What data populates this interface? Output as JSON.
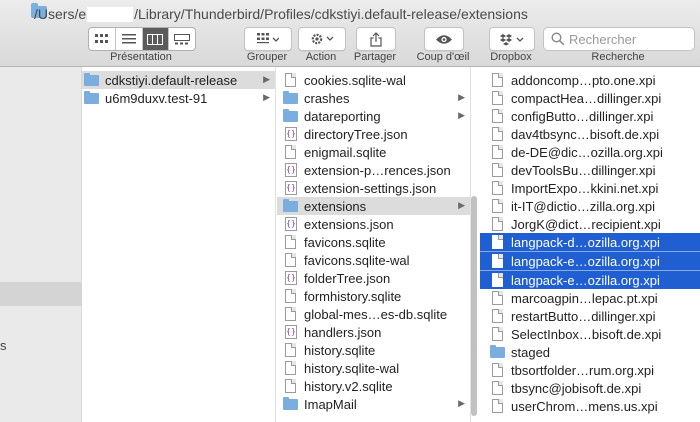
{
  "window": {
    "path_prefix": "/Users/e",
    "path_suffix": "/Library/Thunderbird/Profiles/cdkstiyi.default-release/extensions"
  },
  "toolbar": {
    "view_label": "Présentation",
    "group_label": "Grouper",
    "action_label": "Action",
    "share_label": "Partager",
    "quicklook_label": "Coup d'œil",
    "dropbox_label": "Dropbox",
    "search_label": "Recherche",
    "search_placeholder": "Rechercher"
  },
  "sidebar": {
    "partial_text": "s"
  },
  "column1": {
    "items": [
      {
        "label": "cdkstiyi.default-release",
        "kind": "folder",
        "state": "selected",
        "arrow": true
      },
      {
        "label": "u6m9duxv.test-91",
        "kind": "folder",
        "state": "none",
        "arrow": true
      }
    ]
  },
  "column2": {
    "items": [
      {
        "label": "cookies.sqlite-wal",
        "kind": "doc"
      },
      {
        "label": "crashes",
        "kind": "folder",
        "arrow": true
      },
      {
        "label": "datareporting",
        "kind": "folder",
        "arrow": true
      },
      {
        "label": "directoryTree.json",
        "kind": "json"
      },
      {
        "label": "enigmail.sqlite",
        "kind": "doc"
      },
      {
        "label": "extension-p…rences.json",
        "kind": "json"
      },
      {
        "label": "extension-settings.json",
        "kind": "json"
      },
      {
        "label": "extensions",
        "kind": "folder",
        "arrow": true,
        "state": "selected"
      },
      {
        "label": "extensions.json",
        "kind": "json"
      },
      {
        "label": "favicons.sqlite",
        "kind": "doc"
      },
      {
        "label": "favicons.sqlite-wal",
        "kind": "doc"
      },
      {
        "label": "folderTree.json",
        "kind": "json"
      },
      {
        "label": "formhistory.sqlite",
        "kind": "doc"
      },
      {
        "label": "global-mes…es-db.sqlite",
        "kind": "doc"
      },
      {
        "label": "handlers.json",
        "kind": "json"
      },
      {
        "label": "history.sqlite",
        "kind": "doc"
      },
      {
        "label": "history.sqlite-wal",
        "kind": "doc"
      },
      {
        "label": "history.v2.sqlite",
        "kind": "doc"
      },
      {
        "label": "ImapMail",
        "kind": "folder",
        "arrow": true
      }
    ]
  },
  "column3": {
    "items": [
      {
        "label": "addoncomp…pto.one.xpi",
        "kind": "doc"
      },
      {
        "label": "compactHea…dillinger.xpi",
        "kind": "doc"
      },
      {
        "label": "configButto…dillinger.xpi",
        "kind": "doc"
      },
      {
        "label": "dav4tbsync…bisoft.de.xpi",
        "kind": "doc"
      },
      {
        "label": "de-DE@dic…ozilla.org.xpi",
        "kind": "doc"
      },
      {
        "label": "devToolsBu…dillinger.xpi",
        "kind": "doc"
      },
      {
        "label": "ImportExpo…kkini.net.xpi",
        "kind": "doc"
      },
      {
        "label": "it-IT@dictio…zilla.org.xpi",
        "kind": "doc"
      },
      {
        "label": "JorgK@dict…recipient.xpi",
        "kind": "doc"
      },
      {
        "label": "langpack-d…ozilla.org.xpi",
        "kind": "doc",
        "state": "highlighted"
      },
      {
        "label": "langpack-e…ozilla.org.xpi",
        "kind": "doc",
        "state": "highlighted"
      },
      {
        "label": "langpack-e…ozilla.org.xpi",
        "kind": "doc",
        "state": "highlighted"
      },
      {
        "label": "marcoagpin…lepac.pt.xpi",
        "kind": "doc"
      },
      {
        "label": "restartButto…dillinger.xpi",
        "kind": "doc"
      },
      {
        "label": "SelectInbox…bisoft.de.xpi",
        "kind": "doc"
      },
      {
        "label": "staged",
        "kind": "folder"
      },
      {
        "label": "tbsortfolder…rum.org.xpi",
        "kind": "doc"
      },
      {
        "label": "tbsync@jobisoft.de.xpi",
        "kind": "doc"
      },
      {
        "label": "userChrom…mens.us.xpi",
        "kind": "doc"
      }
    ]
  }
}
